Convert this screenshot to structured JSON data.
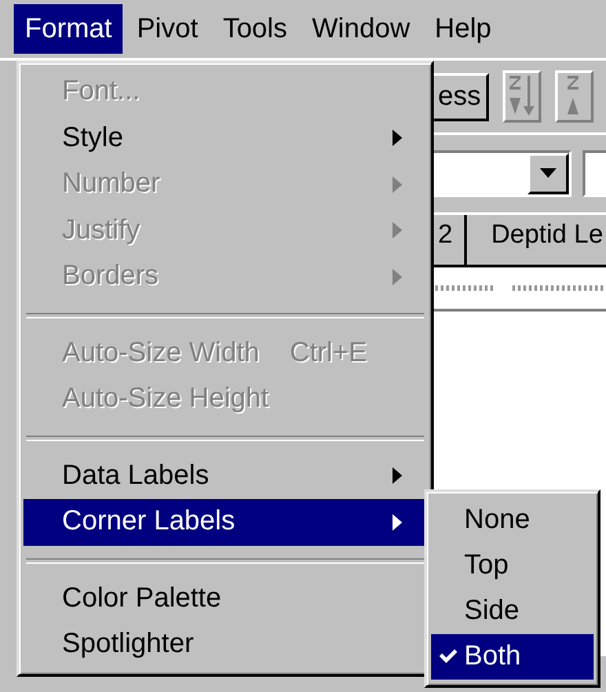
{
  "menu_bar": [
    {
      "label": "Format",
      "selected": true
    },
    {
      "label": "Pivot",
      "selected": false
    },
    {
      "label": "Tools",
      "selected": false
    },
    {
      "label": "Window",
      "selected": false
    },
    {
      "label": "Help",
      "selected": false
    }
  ],
  "background": {
    "button": "ess",
    "header_cells": [
      "2",
      "Deptid Le"
    ]
  },
  "format_menu": [
    {
      "kind": "item",
      "label": "Font...",
      "disabled": true,
      "submenu": false,
      "selected": false
    },
    {
      "kind": "item",
      "label": "Style",
      "disabled": false,
      "submenu": true,
      "selected": false
    },
    {
      "kind": "item",
      "label": "Number",
      "disabled": true,
      "submenu": true,
      "selected": false
    },
    {
      "kind": "item",
      "label": "Justify",
      "disabled": true,
      "submenu": true,
      "selected": false
    },
    {
      "kind": "item",
      "label": "Borders",
      "disabled": true,
      "submenu": true,
      "selected": false
    },
    {
      "kind": "separator"
    },
    {
      "kind": "item",
      "label": "Auto-Size Width",
      "shortcut": "Ctrl+E",
      "disabled": true,
      "submenu": false,
      "selected": false
    },
    {
      "kind": "item",
      "label": "Auto-Size Height",
      "disabled": true,
      "submenu": false,
      "selected": false
    },
    {
      "kind": "separator"
    },
    {
      "kind": "item",
      "label": "Data Labels",
      "disabled": false,
      "submenu": true,
      "selected": false
    },
    {
      "kind": "item",
      "label": "Corner Labels",
      "disabled": false,
      "submenu": true,
      "selected": true
    },
    {
      "kind": "separator"
    },
    {
      "kind": "item",
      "label": "Color Palette",
      "disabled": false,
      "submenu": false,
      "selected": false
    },
    {
      "kind": "item",
      "label": "Spotlighter",
      "disabled": false,
      "submenu": false,
      "selected": false
    }
  ],
  "corner_labels_submenu": [
    {
      "label": "None",
      "checked": false,
      "selected": false
    },
    {
      "label": "Top",
      "checked": false,
      "selected": false
    },
    {
      "label": "Side",
      "checked": false,
      "selected": false
    },
    {
      "label": "Both",
      "checked": true,
      "selected": true
    }
  ]
}
